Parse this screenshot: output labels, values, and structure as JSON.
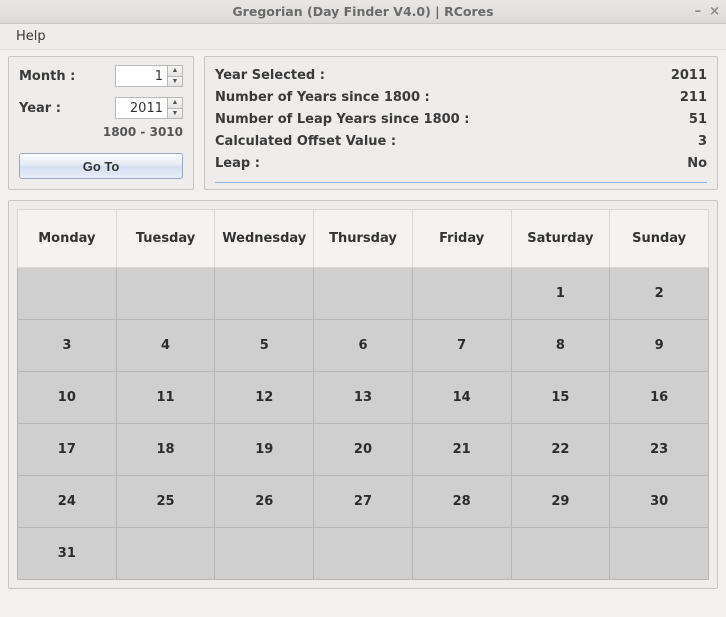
{
  "window": {
    "title": "Gregorian (Day Finder V4.0) | RCores",
    "minimize": "–",
    "close": "×"
  },
  "menu": {
    "help": "Help"
  },
  "controls": {
    "month_label": "Month :",
    "month_value": "1",
    "year_label": "Year :",
    "year_value": "2011",
    "range_hint": "1800 - 3010",
    "goto_label": "Go To"
  },
  "info": {
    "year_selected_label": "Year Selected :",
    "year_selected_value": "2011",
    "years_since_label": "Number of Years since 1800 :",
    "years_since_value": "211",
    "leap_years_label": "Number of Leap Years since 1800 :",
    "leap_years_value": "51",
    "offset_label": "Calculated Offset Value :",
    "offset_value": "3",
    "leap_label": "Leap :",
    "leap_value": "No"
  },
  "calendar": {
    "headers": [
      "Monday",
      "Tuesday",
      "Wednesday",
      "Thursday",
      "Friday",
      "Saturday",
      "Sunday"
    ],
    "rows": [
      [
        "",
        "",
        "",
        "",
        "",
        "1",
        "2"
      ],
      [
        "3",
        "4",
        "5",
        "6",
        "7",
        "8",
        "9"
      ],
      [
        "10",
        "11",
        "12",
        "13",
        "14",
        "15",
        "16"
      ],
      [
        "17",
        "18",
        "19",
        "20",
        "21",
        "22",
        "23"
      ],
      [
        "24",
        "25",
        "26",
        "27",
        "28",
        "29",
        "30"
      ],
      [
        "31",
        "",
        "",
        "",
        "",
        "",
        ""
      ]
    ]
  }
}
